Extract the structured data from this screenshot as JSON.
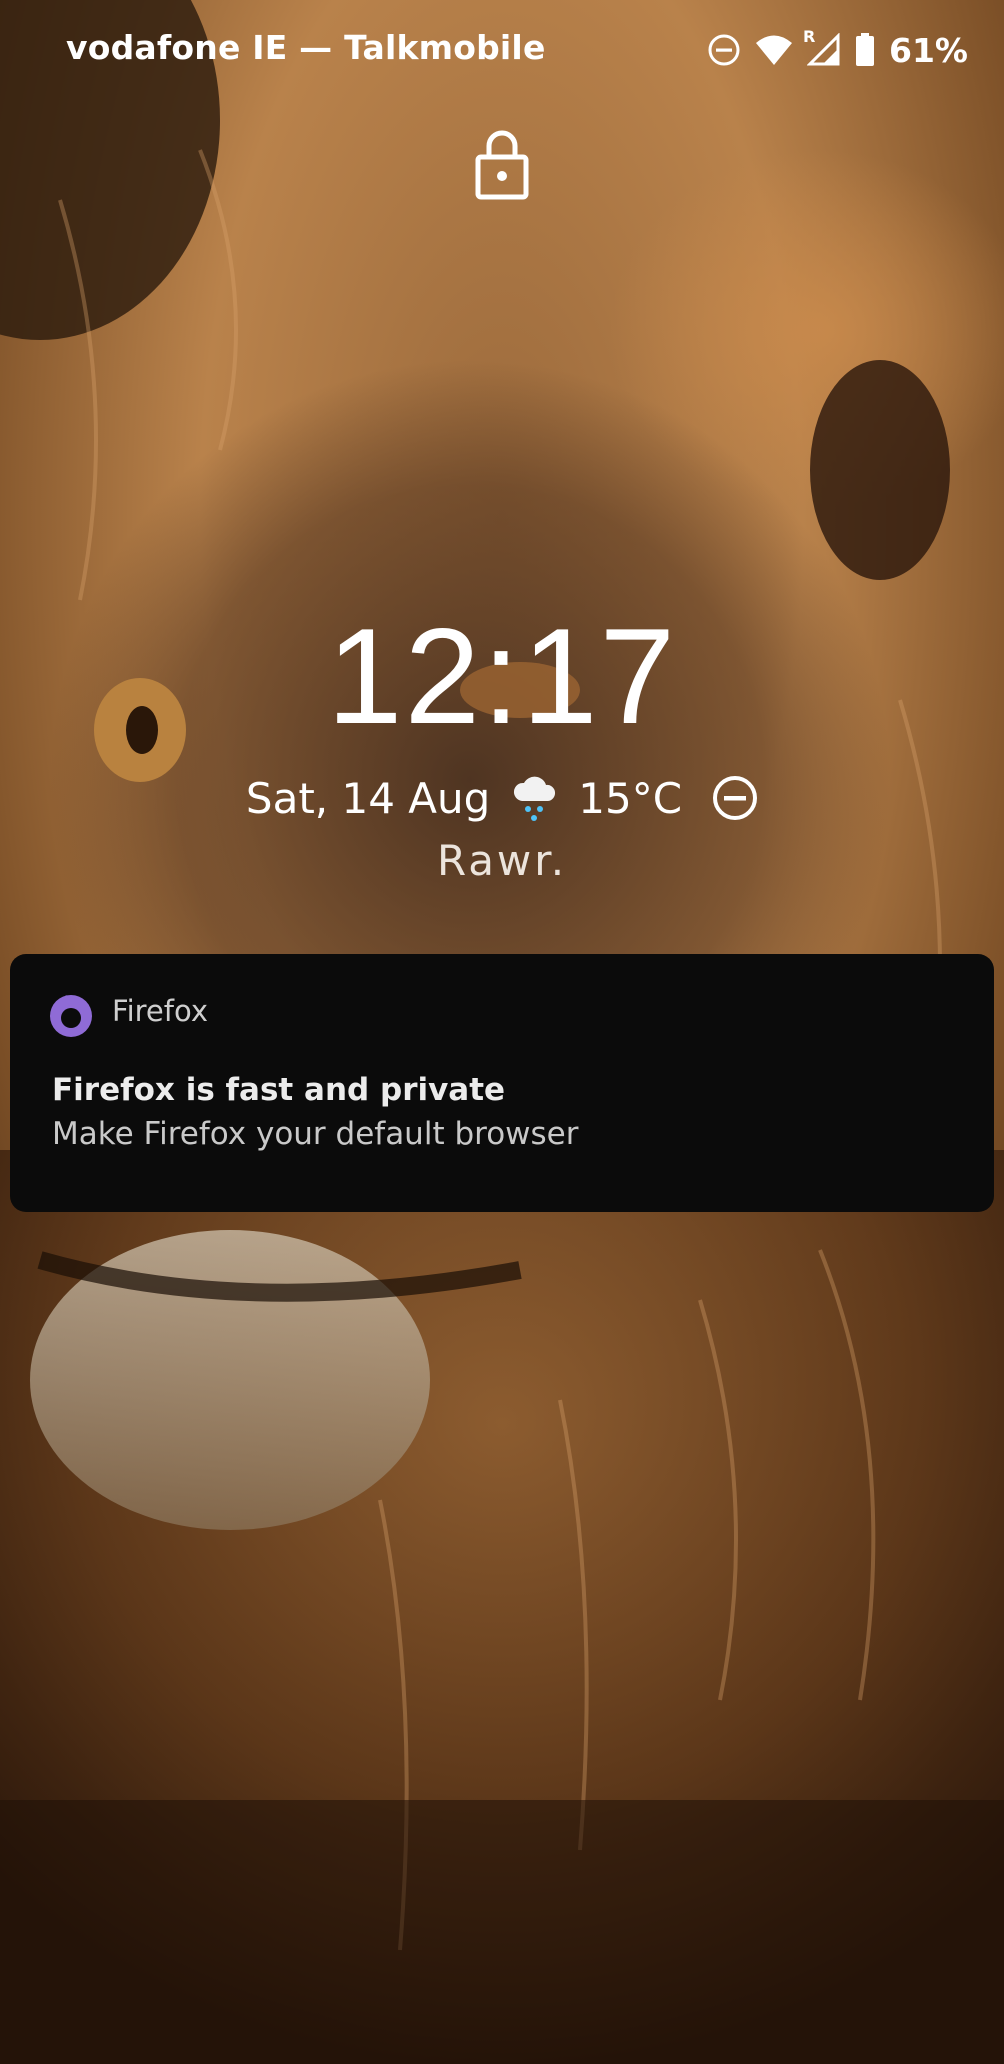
{
  "status_bar": {
    "carrier": "vodafone IE — Talkmobile",
    "battery_percent": "61%",
    "icons": [
      "do-not-disturb-icon",
      "wifi-icon",
      "roaming-indicator",
      "cell-signal-icon",
      "battery-icon"
    ],
    "roaming_label": "R"
  },
  "lock_screen": {
    "lock_icon": "padlock-icon",
    "time": "12:17",
    "date": "Sat, 14 Aug",
    "weather_icon": "cloud-rain-icon",
    "temperature": "15°C",
    "status_icon": "do-not-disturb-icon",
    "owner_info": "Rawr."
  },
  "notification": {
    "app_icon": "firefox-logo-icon",
    "app_name": "Firefox",
    "title": "Firefox is fast and private",
    "text": "Make Firefox your default browser"
  },
  "colors": {
    "text": "#ffffff",
    "notification_bg": "#0b0b0b",
    "firefox_purple": "#8f6bd6",
    "weather_rain": "#4fc3f7"
  }
}
